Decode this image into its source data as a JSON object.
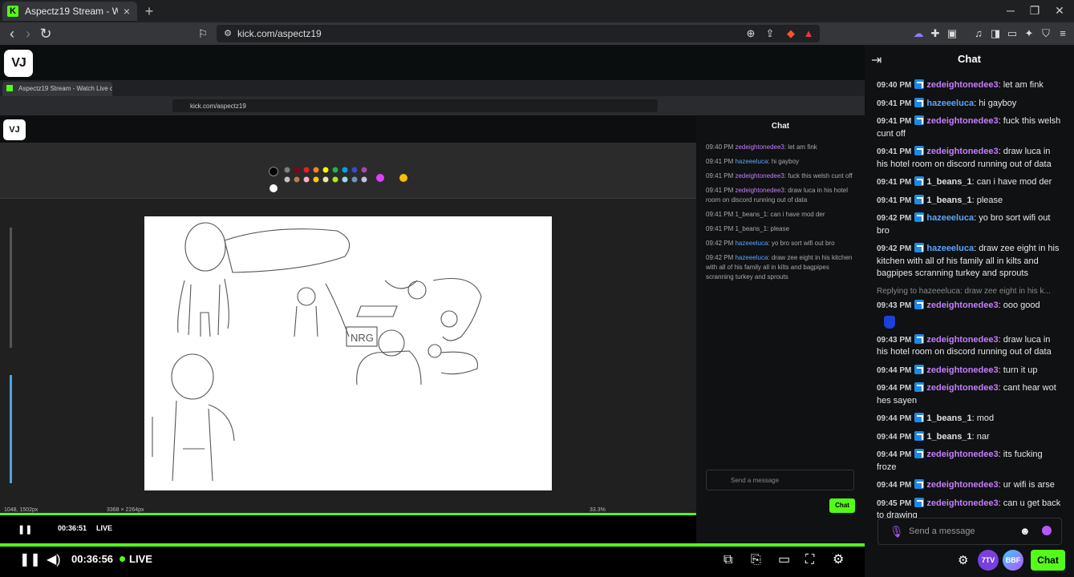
{
  "browser": {
    "tab_title": "Aspectz19 Stream - Watch Live o",
    "url": "kick.com/aspectz19",
    "new_tab": "+",
    "close_tab": "×"
  },
  "site": {
    "logo": "VJ"
  },
  "video": {
    "inner_tab_title": "Aspectz19 Stream - Watch Live o",
    "inner_url": "kick.com/aspectz19",
    "inner_time": "00:36:51",
    "inner_live": "LIVE",
    "inner_chat_title": "Chat",
    "inner_placeholder": "Send a message",
    "inner_chat_button": "Chat",
    "paint_status_left": "1048, 1502px",
    "paint_status_size": "3368 × 2264px",
    "paint_zoom": "33.3%"
  },
  "player": {
    "time": "00:36:56",
    "live": "LIVE"
  },
  "chat": {
    "title": "Chat",
    "placeholder": "Send a message",
    "chat_button": "Chat",
    "seven_tv": "7TV",
    "bttv": "BBF",
    "messages": [
      {
        "time": "09:40 PM",
        "user": "zedeightonedee3",
        "color": "#c77dff",
        "text": "let am fink"
      },
      {
        "time": "09:41 PM",
        "user": "hazeeeluca",
        "color": "#58a6ff",
        "text": "hi gayboy"
      },
      {
        "time": "09:41 PM",
        "user": "zedeightonedee3",
        "color": "#c77dff",
        "text": "fuck this welsh cunt off"
      },
      {
        "time": "09:41 PM",
        "user": "zedeightonedee3",
        "color": "#c77dff",
        "text": "draw luca in his hotel room on discord running out of data"
      },
      {
        "time": "09:41 PM",
        "user": "1_beans_1",
        "color": "#e0e0e0",
        "text": "can i have mod der"
      },
      {
        "time": "09:41 PM",
        "user": "1_beans_1",
        "color": "#e0e0e0",
        "text": "please"
      },
      {
        "time": "09:42 PM",
        "user": "hazeeeluca",
        "color": "#58a6ff",
        "text": "yo bro sort wifi out bro"
      },
      {
        "time": "09:42 PM",
        "user": "hazeeeluca",
        "color": "#58a6ff",
        "text": "draw zee eight in his kitchen with all of his family all in kilts and bagpipes scranning turkey and sprouts"
      },
      {
        "reply": "Replying to hazeeeluca: draw zee eight in his k...",
        "time": "09:43 PM",
        "user": "zedeightonedee3",
        "color": "#c77dff",
        "text": "ooo good",
        "emote": "blue-emote"
      },
      {
        "time": "09:43 PM",
        "user": "zedeightonedee3",
        "color": "#c77dff",
        "text": "draw luca in his hotel room on discord running out of data"
      },
      {
        "time": "09:44 PM",
        "user": "zedeightonedee3",
        "color": "#c77dff",
        "text": "turn it up"
      },
      {
        "time": "09:44 PM",
        "user": "zedeightonedee3",
        "color": "#c77dff",
        "text": "cant hear wot hes sayen"
      },
      {
        "time": "09:44 PM",
        "user": "1_beans_1",
        "color": "#e0e0e0",
        "text": "mod"
      },
      {
        "time": "09:44 PM",
        "user": "1_beans_1",
        "color": "#e0e0e0",
        "text": "nar"
      },
      {
        "time": "09:44 PM",
        "user": "zedeightonedee3",
        "color": "#c77dff",
        "text": "its fucking froze"
      },
      {
        "time": "09:44 PM",
        "user": "zedeightonedee3",
        "color": "#c77dff",
        "text": "ur wifi is arse"
      },
      {
        "time": "09:45 PM",
        "user": "zedeightonedee3",
        "color": "#c77dff",
        "text": "can u get back to drawing"
      }
    ]
  },
  "colors": {
    "kick_green": "#53fc18",
    "accent_purple": "#b657ff"
  }
}
